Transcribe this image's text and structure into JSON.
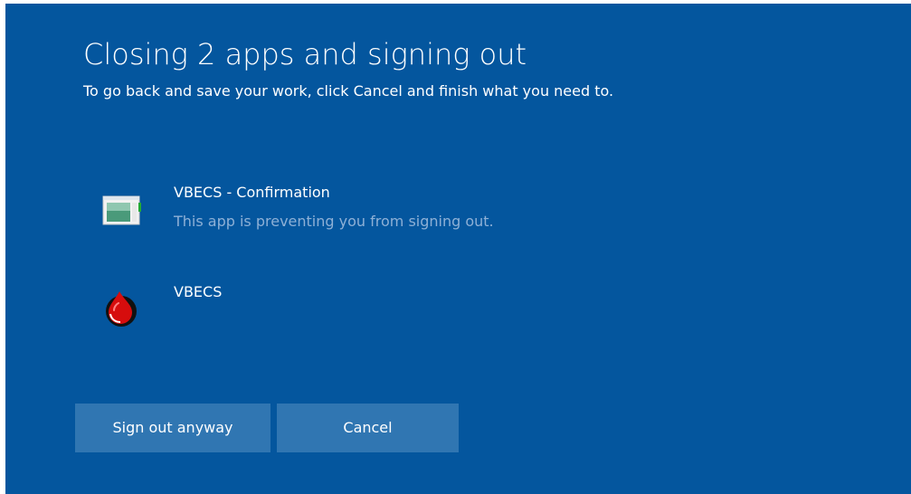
{
  "dialog": {
    "title": "Closing 2 apps and signing out",
    "subtitle": "To go back and save your work, click Cancel and finish what you need to."
  },
  "apps": [
    {
      "name": "VBECS - Confirmation",
      "status": "This app is preventing you from signing out.",
      "icon": "window-icon"
    },
    {
      "name": "VBECS",
      "icon": "blood-drop-icon"
    }
  ],
  "buttons": {
    "sign_out_label": "Sign out anyway",
    "cancel_label": "Cancel"
  },
  "colors": {
    "panel_background": "#04569e",
    "button_background": "#3076b2",
    "status_text": "#8eb0d6",
    "text": "#ffffff"
  }
}
